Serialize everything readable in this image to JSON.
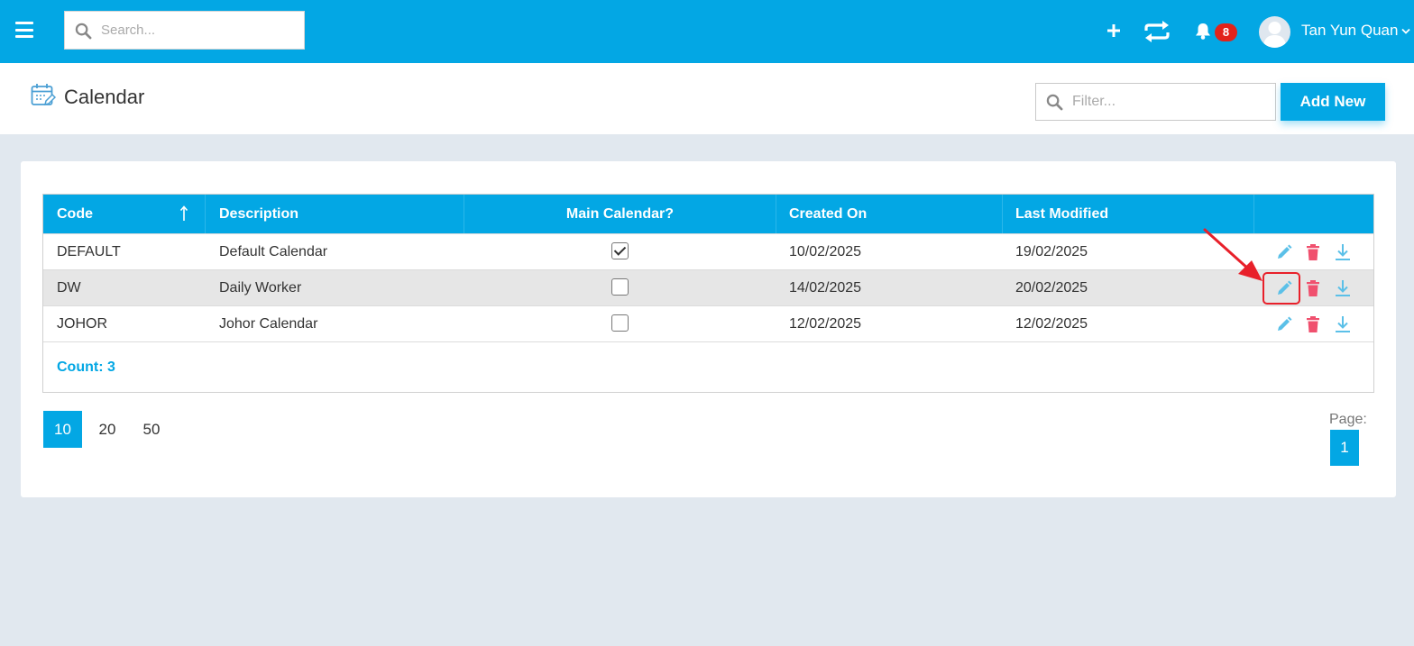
{
  "topbar": {
    "search_placeholder": "Search...",
    "notification_count": "8",
    "user_name": "Tan Yun Quan",
    "icons": [
      "menu-icon",
      "search-icon",
      "plus-icon",
      "sync-icon",
      "bell-icon",
      "avatar",
      "chevron-down-icon"
    ]
  },
  "header": {
    "title": "Calendar",
    "filter_placeholder": "Filter...",
    "add_label": "Add New"
  },
  "table": {
    "columns": [
      "Code",
      "Description",
      "Main Calendar?",
      "Created On",
      "Last Modified"
    ],
    "sort": {
      "column": "Code",
      "direction": "ascending"
    },
    "rows": [
      {
        "code": "DEFAULT",
        "description": "Default Calendar",
        "main": true,
        "created": "10/02/2025",
        "modified": "19/02/2025"
      },
      {
        "code": "DW",
        "description": "Daily Worker",
        "main": false,
        "created": "14/02/2025",
        "modified": "20/02/2025"
      },
      {
        "code": "JOHOR",
        "description": "Johor Calendar",
        "main": false,
        "created": "12/02/2025",
        "modified": "12/02/2025"
      }
    ],
    "count_label": "Count: 3"
  },
  "pagination": {
    "sizes": [
      "10",
      "20",
      "50"
    ],
    "active_size": "10",
    "page_label": "Page:",
    "current_page": "1"
  },
  "colors": {
    "primary": "#03a7e4",
    "delete": "#f0506e",
    "edit": "#5bc0e8",
    "highlight": "#e8202a"
  }
}
